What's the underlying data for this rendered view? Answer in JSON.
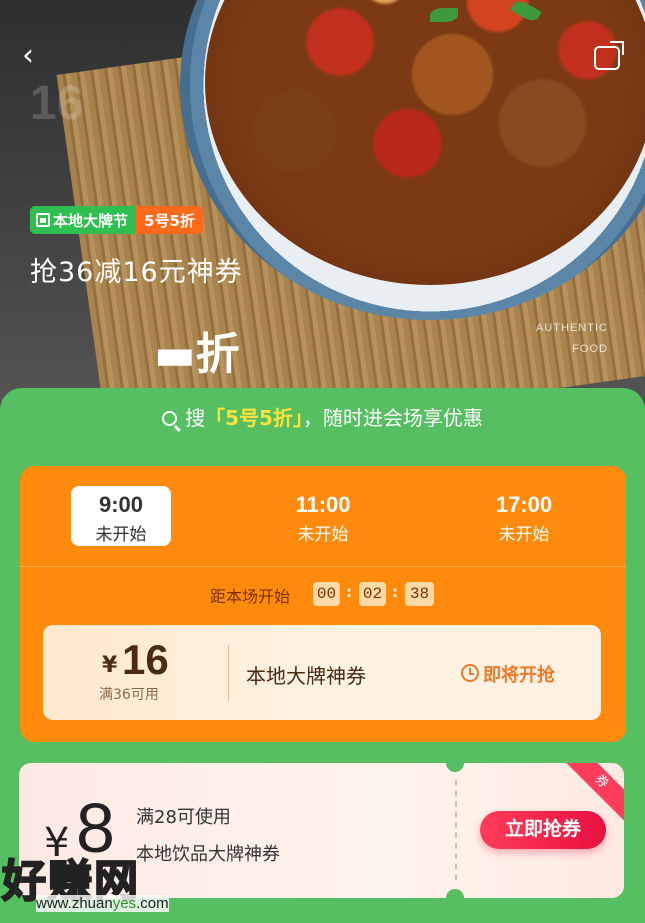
{
  "hero": {
    "back_glyph": "‹",
    "big_number": "16",
    "badge_left": "本地大牌节",
    "badge_right": "5号5折",
    "title": "抢36减16元神券",
    "zhe": "▬折",
    "authentic_line1": "AUTHENTIC",
    "authentic_line2": "FOOD"
  },
  "search_tip": {
    "prefix": "搜",
    "highlight": "「5号5折」",
    "suffix": "，随时进会场享优惠"
  },
  "sessions": [
    {
      "time": "9:00",
      "status": "未开始",
      "active": true
    },
    {
      "time": "11:00",
      "status": "未开始",
      "active": false
    },
    {
      "time": "17:00",
      "status": "未开始",
      "active": false
    }
  ],
  "countdown": {
    "label": "距本场开始",
    "hours": "00",
    "minutes": "02",
    "seconds": "38",
    "sep": ":"
  },
  "coupon1": {
    "currency": "¥",
    "amount": "16",
    "condition": "满36可用",
    "name": "本地大牌神券",
    "status": "即将开抢"
  },
  "coupon2": {
    "currency": "¥",
    "amount": "8",
    "condition": "满28可使用",
    "name": "本地饮品大牌神券",
    "button": "立即抢券",
    "ribbon": "券"
  },
  "watermark": {
    "text": "好赚网",
    "url_prefix": "www.zhuan",
    "url_mid": "yes",
    "url_suffix": ".com"
  },
  "colors": {
    "green": "#55bf61",
    "orange": "#ff8a0c",
    "red_button": "#e8103f",
    "badge_green": "#2fbf4e",
    "badge_orange": "#ff6a1a"
  }
}
